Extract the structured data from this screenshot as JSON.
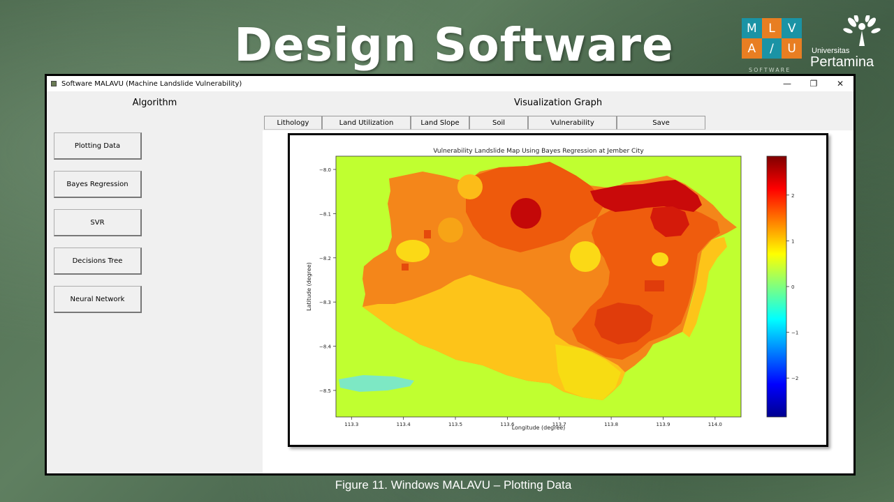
{
  "slide": {
    "title": "Design Software",
    "caption": "Figure 11. Windows MALAVU – Plotting Data",
    "logo_letters": [
      "M",
      "L",
      "V",
      "A",
      "/",
      "U"
    ],
    "logo_sub": "SOFTWARE",
    "university_small": "Universitas",
    "university_big": "Pertamina"
  },
  "window": {
    "title": "Software MALAVU (Machine Landslide Vulnerability)",
    "controls": {
      "minimize": "—",
      "restore": "❐",
      "close": "✕"
    }
  },
  "left_panel": {
    "heading": "Algorithm",
    "buttons": [
      "Plotting Data",
      "Bayes Regression",
      "SVR",
      "Decisions Tree",
      "Neural Network"
    ]
  },
  "right_panel": {
    "heading": "Visualization Graph",
    "tabs": [
      "Lithology",
      "Land Utilization",
      "Land Slope",
      "Soil",
      "Vulnerability",
      "Save"
    ]
  },
  "chart_data": {
    "type": "heatmap",
    "title": "Vulnerability Landslide Map Using Bayes Regression at Jember City",
    "xlabel": "Longitude (degree)",
    "ylabel": "Latitude (degree)",
    "xlim": [
      113.27,
      114.05
    ],
    "ylim": [
      -8.56,
      -7.97
    ],
    "xticks": [
      "113.3",
      "113.4",
      "113.5",
      "113.6",
      "113.7",
      "113.8",
      "113.9",
      "114.0"
    ],
    "yticks": [
      "−8.0",
      "−8.1",
      "−8.2",
      "−8.3",
      "−8.4",
      "−8.5"
    ],
    "colorbar": {
      "colormap": "jet",
      "range": [
        -2.85,
        2.85
      ],
      "ticks": [
        "2",
        "1",
        "0",
        "−1",
        "−2"
      ]
    },
    "background_color": "#c0ff30",
    "colors": {
      "very_high": "#c80000",
      "high": "#e83c00",
      "med_high": "#f46d0e",
      "medium": "#fb9a14",
      "med_low": "#fdc419",
      "low": "#f4e60f"
    }
  }
}
